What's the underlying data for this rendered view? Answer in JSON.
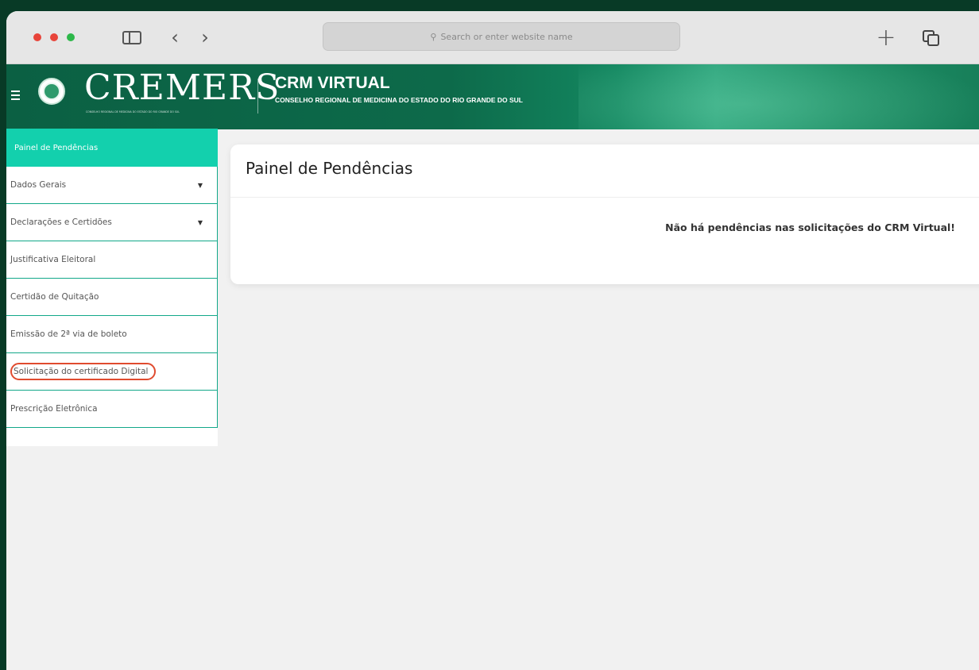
{
  "browser": {
    "address_placeholder": "Search or enter website name"
  },
  "header": {
    "logo_text": "CREMERS",
    "logo_subtitle": "CONSELHO REGIONAL DE MEDICINA DO ESTADO DO RIO GRANDE DO SUL",
    "crm_title": "CRM VIRTUAL",
    "crm_subtitle": "CONSELHO REGIONAL DE MEDICINA DO ESTADO DO RIO GRANDE DO SUL"
  },
  "sidebar": {
    "active_label": "Painel de Pendências",
    "items": [
      {
        "label": "Dados Gerais",
        "has_dropdown": true
      },
      {
        "label": "Declarações e Certidões",
        "has_dropdown": true
      },
      {
        "label": "Justificativa Eleitoral",
        "has_dropdown": false
      },
      {
        "label": "Certidão de Quitação",
        "has_dropdown": false
      },
      {
        "label": "Emissão de 2ª via de boleto",
        "has_dropdown": false
      },
      {
        "label": "Solicitação do certificado Digital",
        "has_dropdown": false,
        "highlighted": true
      },
      {
        "label": "Prescrição Eletrônica",
        "has_dropdown": false
      }
    ]
  },
  "main": {
    "title": "Painel de Pendências",
    "message": "Não há pendências nas solicitações do CRM Virtual!"
  },
  "colors": {
    "header_green": "#0d6a4a",
    "active_teal": "#13d0ad",
    "border_teal": "#12a889",
    "highlight_red": "#e04b2f"
  }
}
